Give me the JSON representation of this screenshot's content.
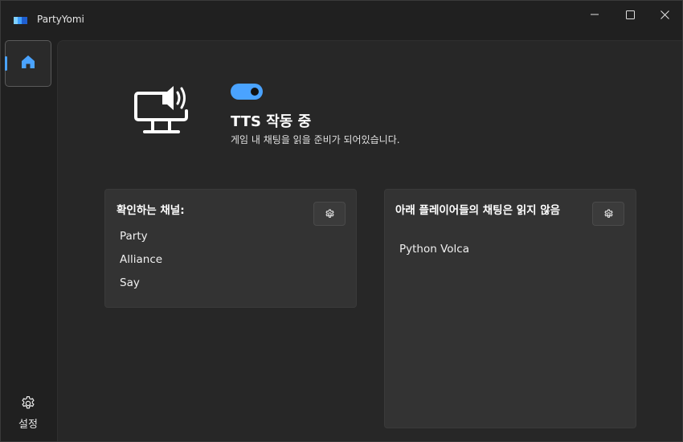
{
  "window": {
    "title": "PartyYomi",
    "icons": [
      "app-icon",
      "minimize-icon",
      "maximize-icon",
      "close-icon"
    ]
  },
  "nav": {
    "home_icon": "home-icon",
    "settings_icon": "gear-icon",
    "settings_label": "설정"
  },
  "status": {
    "toggle_on": true,
    "title": "TTS 작동 중",
    "description": "게임 내 채팅을 읽을 준비가 되어있습니다.",
    "icon": "monitor-speaker-icon"
  },
  "channels_card": {
    "title": "확인하는 채널:",
    "items": [
      "Party",
      "Alliance",
      "Say"
    ],
    "settings_icon": "gear-icon"
  },
  "ignored_card": {
    "title": "아래 플레이어들의 채팅은 읽지 않음",
    "items": [
      "Python Volca"
    ],
    "settings_icon": "gear-icon"
  },
  "colors": {
    "accent": "#4aa3ff",
    "background": "#202020",
    "content": "#272727",
    "card": "#333333"
  }
}
